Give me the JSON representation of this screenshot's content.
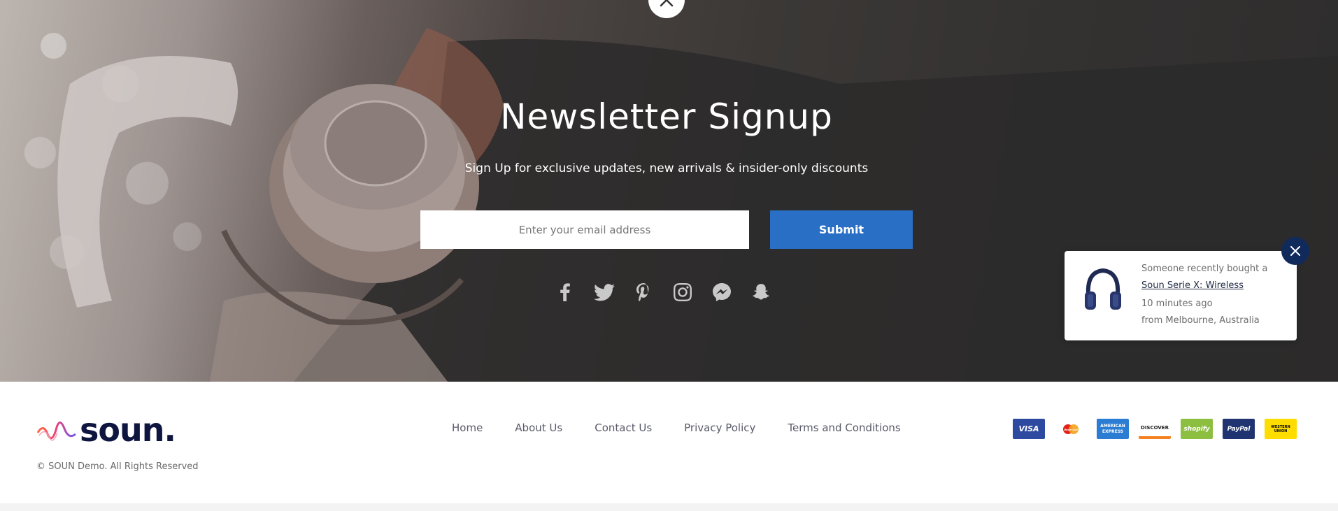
{
  "newsletter": {
    "title": "Newsletter Signup",
    "subtitle": "Sign Up for exclusive updates, new arrivals & insider-only discounts",
    "email_placeholder": "Enter your email address",
    "submit_label": "Submit",
    "social_icons": [
      "facebook-icon",
      "twitter-icon",
      "pinterest-icon",
      "instagram-icon",
      "messenger-icon",
      "snapchat-icon"
    ]
  },
  "purchase_popup": {
    "line1": "Someone recently bought a",
    "product": "Soun Serie X: Wireless",
    "time": "10 minutes ago",
    "location": "from Melbourne, Australia"
  },
  "footer": {
    "brand": "soun.",
    "copyright": "© SOUN Demo. All Rights Reserved",
    "nav": [
      "Home",
      "About Us",
      "Contact Us",
      "Privacy Policy",
      "Terms and Conditions"
    ],
    "payments": {
      "visa": "VISA",
      "mastercard": "MasterCard",
      "amex": "AMERICAN EXPRESS",
      "discover": "DISCOVER",
      "shopify": "shopify",
      "paypal": "PayPal",
      "western_union": "WESTERN UNION"
    }
  },
  "colors": {
    "accent": "#2a6fc6",
    "popup_close": "#112a5c",
    "brand_dark": "#0e1640"
  }
}
